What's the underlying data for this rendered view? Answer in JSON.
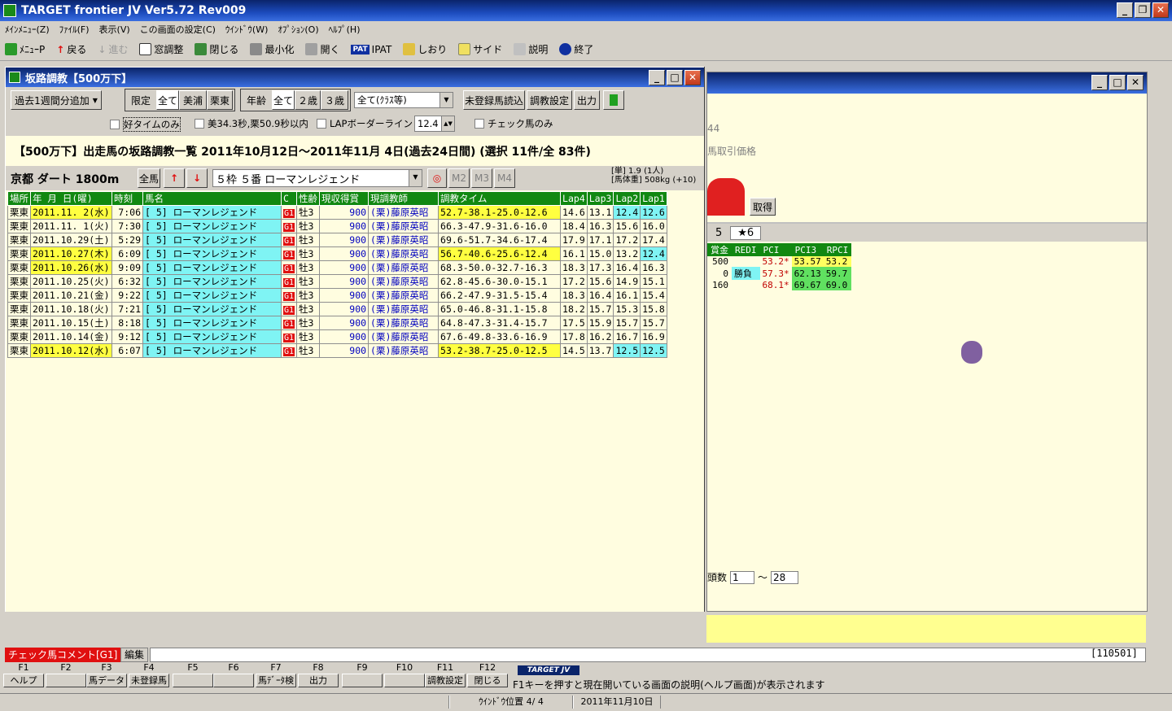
{
  "app": {
    "title": "TARGET frontier JV  Ver5.72  Rev009"
  },
  "menu": [
    "ﾒｲﾝﾒﾆｭｰ(Z)",
    "ﾌｧｲﾙ(F)",
    "表示(V)",
    "この画面の設定(C)",
    "ｳｲﾝﾄﾞｳ(W)",
    "ｵﾌﾟｼｮﾝ(O)",
    "ﾍﾙﾌﾟ(H)"
  ],
  "toolbar": {
    "menu": "ﾒﾆｭｰP",
    "back": "戻る",
    "forward": "進む",
    "window_adjust": "窓調整",
    "close": "閉じる",
    "minimize": "最小化",
    "open": "開く",
    "ipat_logo": "PAT",
    "ipat": "IPAT",
    "bookmark": "しおり",
    "side": "サイド",
    "help": "説明",
    "exit": "終了"
  },
  "window": {
    "title": "坂路調教【500万下】"
  },
  "controls": {
    "add_week": "過去1週間分追加",
    "limit_label": "限定",
    "limit_all": "全て",
    "limit_miho": "美浦",
    "limit_ritto": "栗東",
    "age_label": "年齢",
    "age_all": "全て",
    "age_2": "２歳",
    "age_3": "３歳",
    "class_select": "全て(ｸﾗｽ等)",
    "read_unreg": "未登録馬読込",
    "train_settings": "調教設定",
    "output": "出力",
    "good_time": "好タイムのみ",
    "miho_ritto_limit": "美34.3秒,栗50.9秒以内",
    "lap_border": "LAPボーダーライン",
    "lap_value": "12.4",
    "check_only": "チェック馬のみ"
  },
  "summary": "【500万下】出走馬の坂路調教一覧  2011年10月12日～2011年11月 4日(過去24日間)  (選択 11件/全 83件)",
  "race": {
    "course": "京都 ダート 1800m",
    "all_horses": "全馬",
    "horse_select": "５枠  ５番  ローマンレジェンド",
    "m2": "M2",
    "m3": "M3",
    "m4": "M4",
    "odds_label": "[単]",
    "odds": "1.9 (1人)",
    "weight_label": "[馬体重]",
    "weight": "508kg (+10)"
  },
  "table": {
    "headers": [
      "場所",
      "年  月 日(曜)",
      "時刻",
      "馬名",
      "C",
      "性齢",
      "現収得賞",
      "現調教師",
      "調教タイム",
      "Lap4",
      "Lap3",
      "Lap2",
      "Lap1"
    ],
    "rows": [
      [
        "栗東",
        "2011.11. 2(水)",
        "7:06",
        "[ 5]  ローマンレジェンド",
        "G1",
        "牡3",
        "900",
        "(栗)藤原英昭",
        "52.7-38.1-25.0-12.6",
        "14.6",
        "13.1",
        "12.4",
        "12.6"
      ],
      [
        "栗東",
        "2011.11. 1(火)",
        "7:30",
        "[ 5]  ローマンレジェンド",
        "G1",
        "牡3",
        "900",
        "(栗)藤原英昭",
        "66.3-47.9-31.6-16.0",
        "18.4",
        "16.3",
        "15.6",
        "16.0"
      ],
      [
        "栗東",
        "2011.10.29(土)",
        "5:29",
        "[ 5]  ローマンレジェンド",
        "G1",
        "牡3",
        "900",
        "(栗)藤原英昭",
        "69.6-51.7-34.6-17.4",
        "17.9",
        "17.1",
        "17.2",
        "17.4"
      ],
      [
        "栗東",
        "2011.10.27(木)",
        "6:09",
        "[ 5]  ローマンレジェンド",
        "G1",
        "牡3",
        "900",
        "(栗)藤原英昭",
        "56.7-40.6-25.6-12.4",
        "16.1",
        "15.0",
        "13.2",
        "12.4"
      ],
      [
        "栗東",
        "2011.10.26(水)",
        "9:09",
        "[ 5]  ローマンレジェンド",
        "G1",
        "牡3",
        "900",
        "(栗)藤原英昭",
        "68.3-50.0-32.7-16.3",
        "18.3",
        "17.3",
        "16.4",
        "16.3"
      ],
      [
        "栗東",
        "2011.10.25(火)",
        "6:32",
        "[ 5]  ローマンレジェンド",
        "G1",
        "牡3",
        "900",
        "(栗)藤原英昭",
        "62.8-45.6-30.0-15.1",
        "17.2",
        "15.6",
        "14.9",
        "15.1"
      ],
      [
        "栗東",
        "2011.10.21(金)",
        "9:22",
        "[ 5]  ローマンレジェンド",
        "G1",
        "牡3",
        "900",
        "(栗)藤原英昭",
        "66.2-47.9-31.5-15.4",
        "18.3",
        "16.4",
        "16.1",
        "15.4"
      ],
      [
        "栗東",
        "2011.10.18(火)",
        "7:21",
        "[ 5]  ローマンレジェンド",
        "G1",
        "牡3",
        "900",
        "(栗)藤原英昭",
        "65.0-46.8-31.1-15.8",
        "18.2",
        "15.7",
        "15.3",
        "15.8"
      ],
      [
        "栗東",
        "2011.10.15(土)",
        "8:18",
        "[ 5]  ローマンレジェンド",
        "G1",
        "牡3",
        "900",
        "(栗)藤原英昭",
        "64.8-47.3-31.4-15.7",
        "17.5",
        "15.9",
        "15.7",
        "15.7"
      ],
      [
        "栗東",
        "2011.10.14(金)",
        "9:12",
        "[ 5]  ローマンレジェンド",
        "G1",
        "牡3",
        "900",
        "(栗)藤原英昭",
        "67.6-49.8-33.6-16.9",
        "17.8",
        "16.2",
        "16.7",
        "16.9"
      ],
      [
        "栗東",
        "2011.10.12(水)",
        "6:07",
        "[ 5]  ローマンレジェンド",
        "G1",
        "牡3",
        "900",
        "(栗)藤原英昭",
        "53.2-38.7-25.0-12.5",
        "14.5",
        "13.7",
        "12.5",
        "12.5"
      ]
    ]
  },
  "back": {
    "line1": "44",
    "line2": "馬取引価格",
    "acquire": "取得",
    "tab1": "5",
    "tab2": "★6",
    "headers": [
      "賞金",
      "REDI",
      "PCI",
      "PCI3",
      "RPCI"
    ],
    "rows": [
      [
        "500",
        "",
        "53.2*",
        "53.57",
        "53.2"
      ],
      [
        "0",
        "勝負",
        "57.3*",
        "62.13",
        "59.7"
      ],
      [
        "160",
        "",
        "68.1*",
        "69.67",
        "69.0"
      ]
    ],
    "count_label": "頭数",
    "from": "1",
    "tilde": "～",
    "to": "28"
  },
  "bottom": {
    "check_comment": "チェック馬コメント[G1]",
    "edit": "編集",
    "code": "[110501]",
    "logo": "TARGET JV",
    "hint": "F1キーを押すと現在開いている画面の説明(ヘルプ画面)が表示されます",
    "win_pos": "ｳｲﾝﾄﾞｳ位置 4/ 4",
    "date": "2011年11月10日",
    "fkeys": [
      [
        "F1",
        "ヘルプ"
      ],
      [
        "F2",
        ""
      ],
      [
        "F3",
        "馬データ"
      ],
      [
        "F4",
        "未登録馬"
      ],
      [
        "F5",
        ""
      ],
      [
        "F6",
        ""
      ],
      [
        "F7",
        "馬ﾃﾞｰﾀ検"
      ],
      [
        "F8",
        "出力"
      ],
      [
        "F9",
        ""
      ],
      [
        "F10",
        ""
      ],
      [
        "F11",
        "調教設定"
      ],
      [
        "F12",
        "閉じる"
      ]
    ]
  },
  "colors": {
    "header_green": "#118811",
    "highlight_yellow": "#ffff40",
    "highlight_cyan": "#7ff4f4",
    "badge_red": "#e01010"
  }
}
